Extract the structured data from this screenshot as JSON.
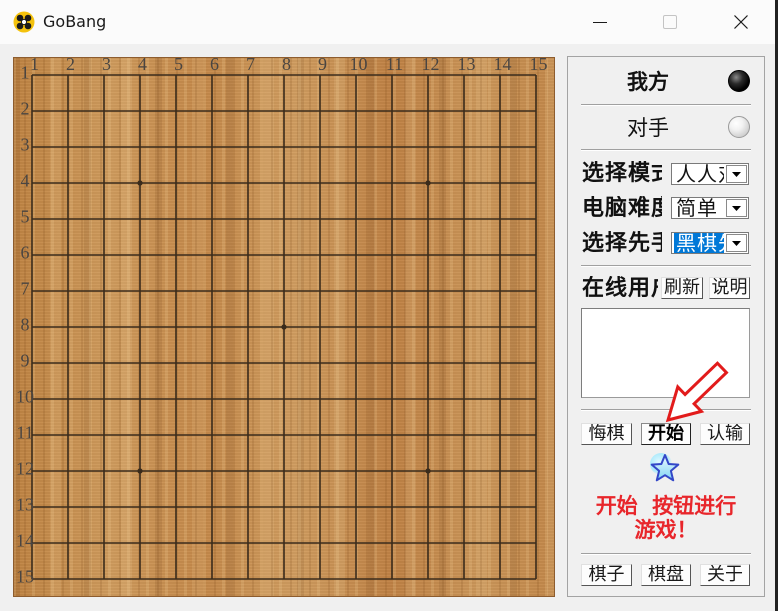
{
  "window": {
    "title": "GoBang",
    "app_icon": "gobang-app-icon",
    "minimize_icon": "minimize-icon",
    "maximize_icon": "maximize-icon",
    "maximize_enabled": false,
    "close_icon": "close-icon"
  },
  "board": {
    "size": 15,
    "column_labels": [
      "1",
      "2",
      "3",
      "4",
      "5",
      "6",
      "7",
      "8",
      "9",
      "10",
      "11",
      "12",
      "13",
      "14",
      "15"
    ],
    "row_labels": [
      "1",
      "2",
      "3",
      "4",
      "5",
      "6",
      "7",
      "8",
      "9",
      "10",
      "11",
      "12",
      "13",
      "14",
      "15"
    ],
    "star_points": [
      [
        4,
        4
      ],
      [
        12,
        4
      ],
      [
        8,
        8
      ],
      [
        4,
        12
      ],
      [
        12,
        12
      ]
    ],
    "colors": {
      "wood": "#c58b4b",
      "grid": "#3a2b1b",
      "label": "#4a4541"
    }
  },
  "panel": {
    "self": {
      "label": "我方",
      "stone": "black"
    },
    "opponent": {
      "label": "对手",
      "stone": "white"
    },
    "settings": [
      {
        "label": "选择模式",
        "value": "人人对战",
        "highlighted": false
      },
      {
        "label": "电脑难度",
        "value": "简单",
        "highlighted": false
      },
      {
        "label": "选择先手",
        "value": "黑棋先手",
        "highlighted": true
      }
    ],
    "online": {
      "label": "在线用户",
      "refresh_label": "刷新",
      "help_label": "说明"
    },
    "actions": {
      "undo_label": "悔棋",
      "start_label": "开始",
      "resign_label": "认输"
    },
    "hint": {
      "icon": "star-icon",
      "lines": [
        "开始  按钮进行",
        "游戏！"
      ],
      "color": "#e8262b"
    },
    "footer": {
      "stones_label": "棋子",
      "board_label": "棋盘",
      "about_label": "关于"
    }
  },
  "annotation": {
    "icon": "arrow-icon",
    "color": "#e21b1b"
  }
}
